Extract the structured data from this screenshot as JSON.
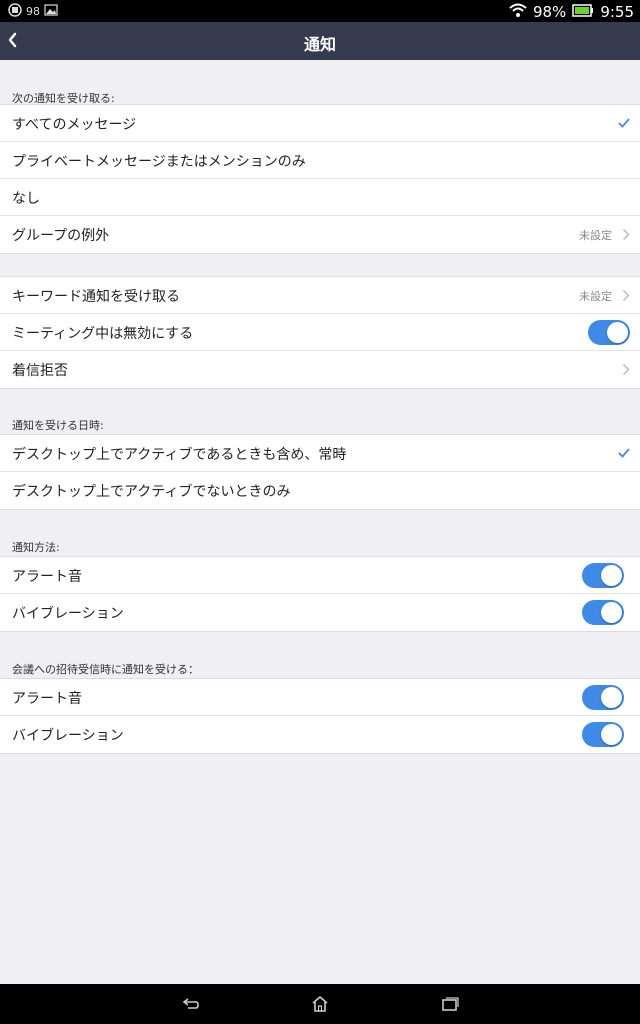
{
  "status": {
    "left_badge": "98",
    "battery": "98%",
    "time": "9:55"
  },
  "header": {
    "title": "通知"
  },
  "receive": {
    "heading": "次の通知を受け取る:",
    "items": [
      {
        "label": "すべてのメッセージ"
      },
      {
        "label": "プライベートメッセージまたはメンションのみ"
      },
      {
        "label": "なし"
      },
      {
        "label": "グループの例外",
        "value": "未設定"
      }
    ]
  },
  "options": {
    "items": [
      {
        "label": "キーワード通知を受け取る",
        "value": "未設定"
      },
      {
        "label": "ミーティング中は無効にする",
        "toggle": true
      },
      {
        "label": "着信拒否"
      }
    ]
  },
  "when": {
    "heading": "通知を受ける日時:",
    "items": [
      {
        "label": "デスクトップ上でアクティブであるときも含め、常時"
      },
      {
        "label": "デスクトップ上でアクティブでないときのみ"
      }
    ]
  },
  "method": {
    "heading": "通知方法:",
    "items": [
      {
        "label": "アラート音",
        "toggle": true
      },
      {
        "label": "バイブレーション",
        "toggle": true
      }
    ]
  },
  "meeting_invite": {
    "heading": "会議への招待受信時に通知を受ける：",
    "items": [
      {
        "label": "アラート音",
        "toggle": true
      },
      {
        "label": "バイブレーション",
        "toggle": true
      }
    ]
  },
  "colors": {
    "accent": "#3f8ae6",
    "appbar": "#353a4e",
    "background": "#efeff4"
  }
}
